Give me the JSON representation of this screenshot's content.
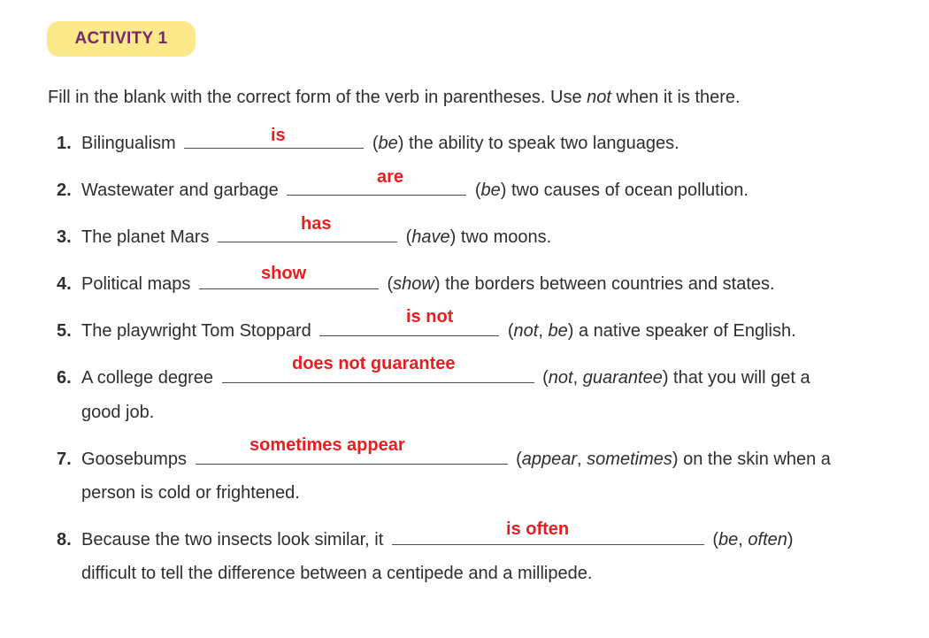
{
  "activity": {
    "label": "ACTIVITY 1"
  },
  "instructions": {
    "before": "Fill in the blank with the correct form of the verb in parentheses. Use ",
    "emphasis": "not",
    "after": " when it is there."
  },
  "items": [
    {
      "number": "1.",
      "prompt": "Bilingualism",
      "answer": "is",
      "hint": "be",
      "rest": " the ability to speak two languages."
    },
    {
      "number": "2.",
      "prompt": "Wastewater and garbage",
      "answer": "are",
      "hint": "be",
      "rest": " two causes of ocean pollution."
    },
    {
      "number": "3.",
      "prompt": "The planet Mars",
      "answer": "has",
      "hint": "have",
      "rest": " two moons."
    },
    {
      "number": "4.",
      "prompt": "Political maps",
      "answer": "show",
      "hint": "show",
      "rest": " the borders between countries and states."
    },
    {
      "number": "5.",
      "prompt": "The playwright Tom Stoppard",
      "answer": "is not",
      "hint1": "not",
      "hint2": "be",
      "rest": " a native speaker of English."
    },
    {
      "number": "6.",
      "prompt": "A college degree",
      "answer": "does not guarantee",
      "hint1": "not",
      "hint2": "guarantee",
      "rest": " that you will get a",
      "continuation": "good job."
    },
    {
      "number": "7.",
      "prompt": "Goosebumps",
      "answer": "sometimes appear",
      "hint1": "appear",
      "hint2": "sometimes",
      "rest": " on the skin when a",
      "continuation": "person is cold or frightened."
    },
    {
      "number": "8.",
      "prompt": "Because the two insects look similar, it",
      "answer": "is often",
      "hint1": "be",
      "hint2": "often",
      "rest": "",
      "continuation": "difficult to tell the difference between a centipede and a millipede."
    }
  ],
  "colors": {
    "badge_bg": "#fce98a",
    "badge_text": "#7a2572",
    "answer": "#ee1c1c",
    "text": "#2e2e2e"
  }
}
